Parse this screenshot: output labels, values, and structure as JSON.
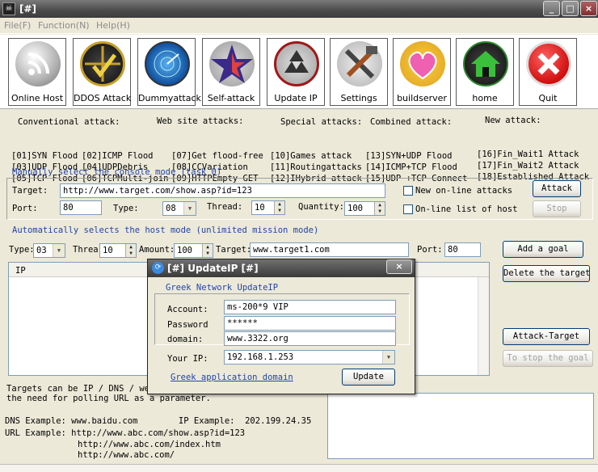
{
  "window": {
    "title": "[#]",
    "icon_text": "☠"
  },
  "menu": [
    "File(F)",
    "Function(N)",
    "Help(H)"
  ],
  "toolbar": [
    {
      "label": "Online Host",
      "icon": "rss-icon",
      "color": "#8a8a8a"
    },
    {
      "label": "DDOS Attack",
      "icon": "target-check-icon",
      "color": "#c8a02a"
    },
    {
      "label": "Dummyattack",
      "icon": "radar-icon",
      "color": "#2a7ad0"
    },
    {
      "label": "Self-attack",
      "icon": "star-icon",
      "color": "#3a2a8a"
    },
    {
      "label": "Update IP",
      "icon": "recycle-icon",
      "color": "#a01818"
    },
    {
      "label": "Settings",
      "icon": "tools-icon",
      "color": "#7a7a7a"
    },
    {
      "label": "buildserver",
      "icon": "heart-icon",
      "color": "#e040a0"
    },
    {
      "label": "home",
      "icon": "home-icon",
      "color": "#2a8a2a"
    },
    {
      "label": "Quit",
      "icon": "quit-icon",
      "color": "#e02020"
    }
  ],
  "attacks": {
    "conventional": {
      "header": "Conventional attack:",
      "col1": [
        "[01]SYN Flood",
        "[03]UDP Flood",
        "[05]TCP Flood"
      ],
      "col2": [
        "[02]ICMP Flood",
        "[04]UDPDebris",
        "[06]TCPMulti-join"
      ]
    },
    "website": {
      "header": "Web site attacks:",
      "items": [
        "[07]Get flood-free",
        "[08]CCVariation",
        "[09]HTTPEmpty GET"
      ]
    },
    "special": {
      "header": "Special attacks:",
      "items": [
        "[10]Games attack",
        "[11]Routingattacks",
        "[12]IHybrid attack"
      ]
    },
    "combined": {
      "header": "Combined attack:",
      "items": [
        "[13]SYN+UDP Flood",
        "[14]ICMP+TCP Flood",
        "[15]UDP +TCP Connect"
      ]
    },
    "new": {
      "header": "New attack:",
      "items": [
        "[16]Fin_Wait1 Attack",
        "[17]Fin_Wait2 Attack",
        "[18]Established Attack"
      ]
    }
  },
  "manual": {
    "title": "Manually select the console mode (task 0)",
    "target_label": "Target:",
    "target_value": "http://www.target.com/show.asp?id=123",
    "port_label": "Port:",
    "port_value": "80",
    "type_label": "Type:",
    "type_value": "08",
    "thread_label": "Thread:",
    "thread_value": "10",
    "quantity_label": "Quantity:",
    "quantity_value": "100",
    "new_online_label": "New on-line attacks",
    "online_list_label": "On-line list of host",
    "attack_button": "Attack",
    "stop_button": "Stop"
  },
  "auto": {
    "title": "Automatically selects the host mode (unlimited mission mode)",
    "type_label": "Type:",
    "type_value": "03",
    "thread_label": "Threa",
    "thread_value": "10",
    "amount_label": "Amount:",
    "amount_value": "100",
    "target_label": "Target:",
    "target_value": "www.target1.com",
    "port_label": "Port:",
    "port_value": "80",
    "add_button": "Add a goal",
    "delete_button": "Delete the target",
    "attack_target_button": "Attack-Target",
    "stop_goal_button": "To stop the goal",
    "list_header": "IP"
  },
  "help": {
    "line1": "Targets can be IP / DNS / web",
    "line2": "the need for polling URL as a parameter.",
    "dns": "DNS Example: www.baidu.com        IP Example:  202.199.24.35",
    "url1": "URL Example: http://www.abc.com/show.asp?id=123",
    "url2": "http://www.abc.com/index.htm",
    "url3": "http://www.abc.com/"
  },
  "dialog": {
    "title": "[#] UpdateIP [#]",
    "heading": "Greek Network UpdateIP",
    "account_label": "Account:",
    "account_value": "ms-200*9 VIP",
    "password_label": "Password",
    "password_value": "******",
    "domain_label": "domain:",
    "domain_value": "www.3322.org",
    "ip_label": "Your IP:",
    "ip_value": "192.168.1.253",
    "link": "Greek application domain",
    "update_button": "Update"
  }
}
